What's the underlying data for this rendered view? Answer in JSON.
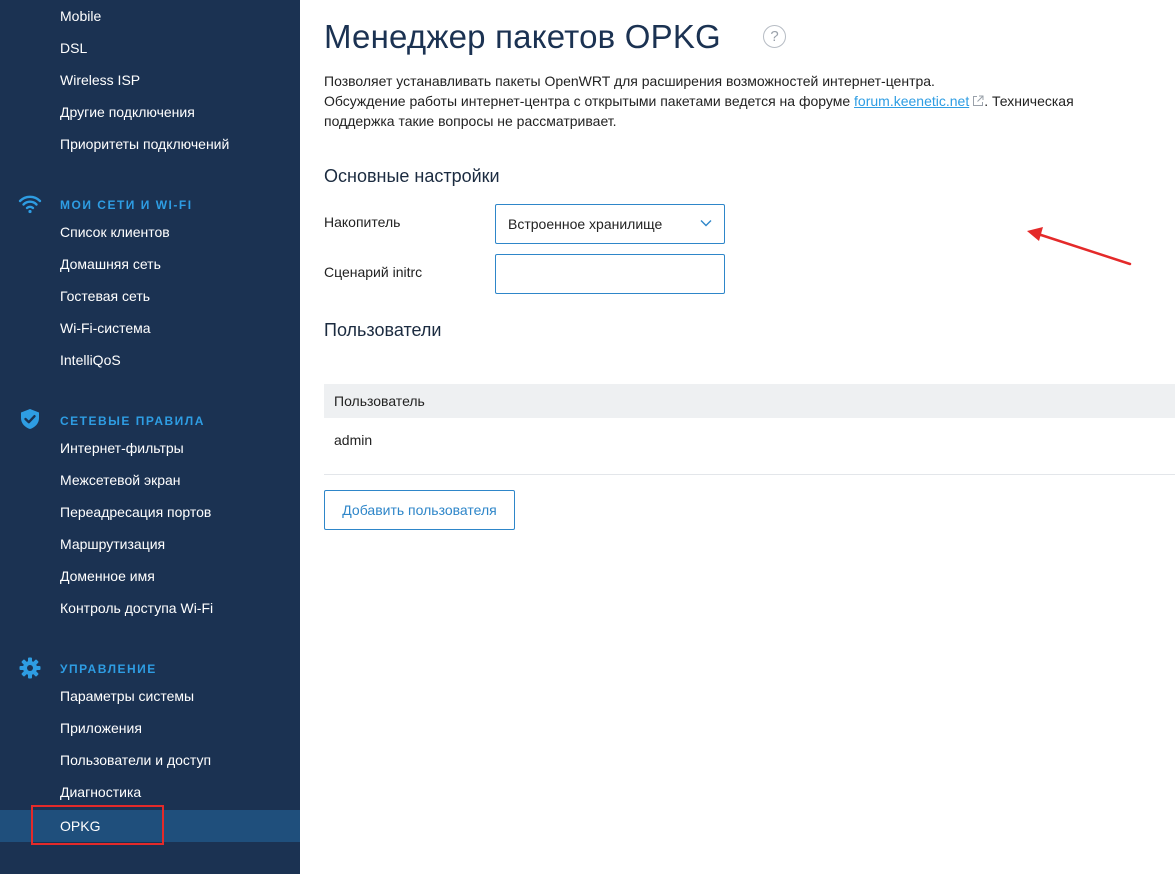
{
  "colors": {
    "sidebar_bg": "#1b3252",
    "sidebar_active_bg": "#1f4f7c",
    "accent": "#2e9de3",
    "annotation_red": "#e42a2a"
  },
  "sidebar": {
    "items_top": [
      {
        "label": "Mobile"
      },
      {
        "label": "DSL"
      },
      {
        "label": "Wireless ISP"
      },
      {
        "label": "Другие подключения"
      },
      {
        "label": "Приоритеты подключений"
      }
    ],
    "sections": [
      {
        "title": "МОИ СЕТИ И WI-FI",
        "icon": "wifi-icon",
        "items": [
          {
            "label": "Список клиентов"
          },
          {
            "label": "Домашняя сеть"
          },
          {
            "label": "Гостевая сеть"
          },
          {
            "label": "Wi-Fi-система"
          },
          {
            "label": "IntelliQoS"
          }
        ]
      },
      {
        "title": "СЕТЕВЫЕ ПРАВИЛА",
        "icon": "shield-check-icon",
        "items": [
          {
            "label": "Интернет-фильтры"
          },
          {
            "label": "Межсетевой экран"
          },
          {
            "label": "Переадресация портов"
          },
          {
            "label": "Маршрутизация"
          },
          {
            "label": "Доменное имя"
          },
          {
            "label": "Контроль доступа Wi-Fi"
          }
        ]
      },
      {
        "title": "УПРАВЛЕНИЕ",
        "icon": "gear-icon",
        "items": [
          {
            "label": "Параметры системы"
          },
          {
            "label": "Приложения"
          },
          {
            "label": "Пользователи и доступ"
          },
          {
            "label": "Диагностика"
          },
          {
            "label": "OPKG",
            "active": true
          }
        ]
      }
    ]
  },
  "main": {
    "title": "Менеджер пакетов OPKG",
    "help_glyph": "?",
    "description_line1": "Позволяет устанавливать пакеты OpenWRT для расширения возможностей интернет-центра.",
    "description_line2_before": "Обсуждение работы интернет-центра с открытыми пакетами ведется на форуме ",
    "forum_link": "forum.keenetic.net",
    "description_line2_after": ". Техническая",
    "description_line3": "поддержка такие вопросы не рассматривает.",
    "settings": {
      "heading": "Основные настройки",
      "storage_label": "Накопитель",
      "storage_value": "Встроенное хранилище",
      "initrc_label": "Сценарий initrc",
      "initrc_value": ""
    },
    "users": {
      "heading": "Пользователи",
      "column_header": "Пользователь",
      "rows": [
        {
          "name": "admin"
        }
      ],
      "add_button": "Добавить пользователя"
    }
  }
}
